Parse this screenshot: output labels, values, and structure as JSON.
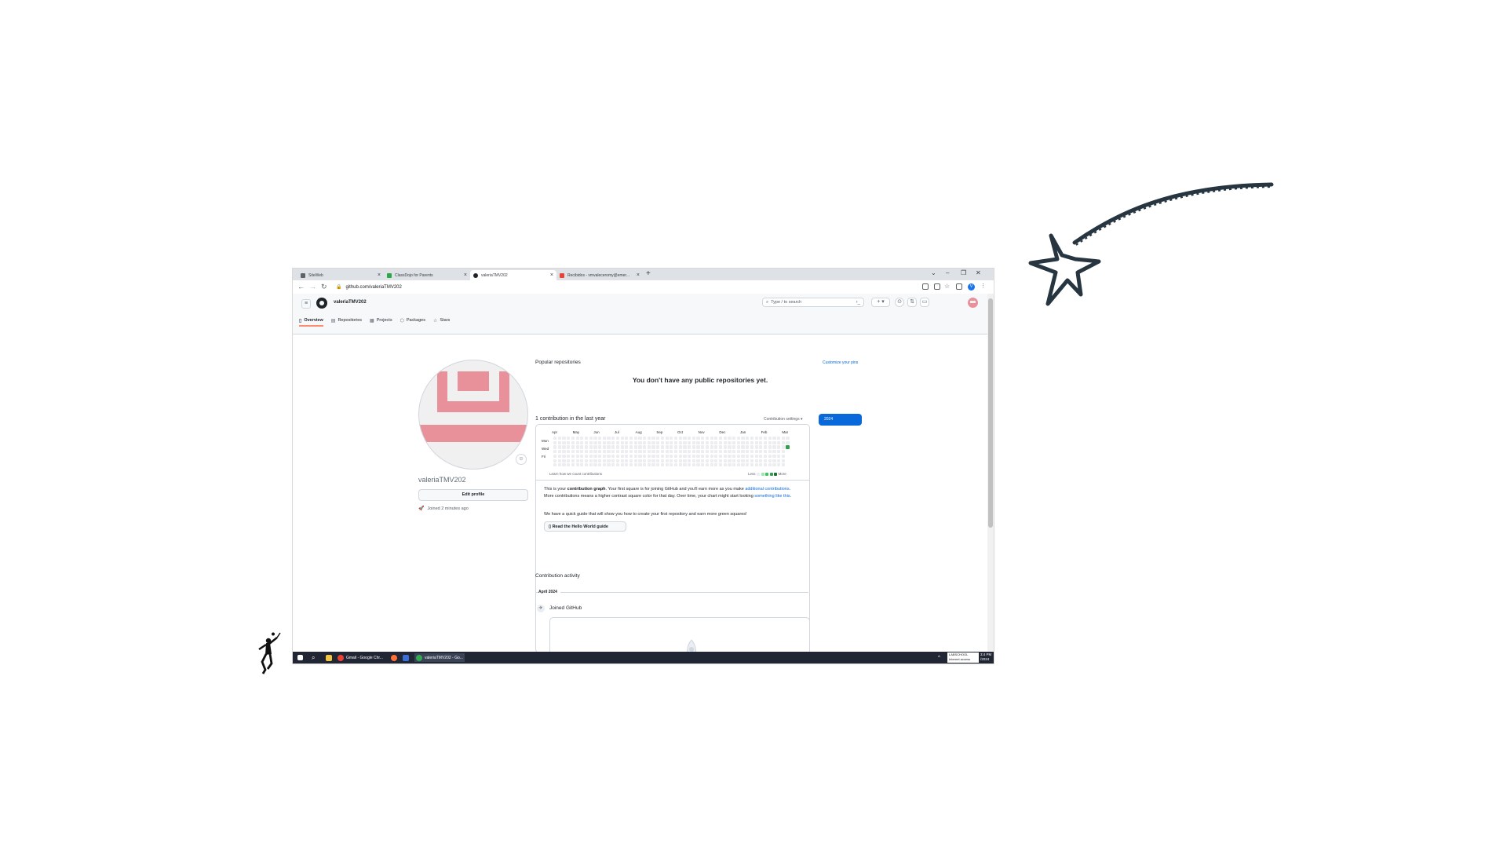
{
  "browser": {
    "tabs": [
      {
        "label": "SiteWeb"
      },
      {
        "label": "ClassDojo for Parents"
      },
      {
        "label": "valeriaTMV202"
      },
      {
        "label": "Recibidos - vmvaleceromy@emer..."
      }
    ],
    "new_tab_symbol": "+",
    "window_controls": [
      "⌄",
      "–",
      "❐",
      "✕"
    ],
    "address": "github.com/valeriaTMV202",
    "profile_initial": "V"
  },
  "github": {
    "username": "valeriaTMV202",
    "search_placeholder": "Type / to search",
    "nav_tabs": [
      {
        "label": "Overview",
        "icon": "book-icon"
      },
      {
        "label": "Repositories",
        "icon": "repo-icon"
      },
      {
        "label": "Projects",
        "icon": "table-icon"
      },
      {
        "label": "Packages",
        "icon": "package-icon"
      },
      {
        "label": "Stars",
        "icon": "star-icon"
      }
    ],
    "profile": {
      "name": "valeriaTMV202",
      "edit_label": "Edit profile",
      "joined": "Joined 2 minutes ago"
    },
    "popular": {
      "title": "Popular repositories",
      "customize": "Customize your pins",
      "empty": "You don't have any public repositories yet."
    },
    "contributions": {
      "count_text": "1 contribution in the last year",
      "settings": "Contribution settings ▾",
      "year": "2024",
      "months": [
        "Apr",
        "May",
        "Jun",
        "Jul",
        "Aug",
        "Sep",
        "Oct",
        "Nov",
        "Dec",
        "Jan",
        "Feb",
        "Mar"
      ],
      "days": [
        "Mon",
        "Wed",
        "Fri"
      ],
      "learn": "Learn how we count contributions",
      "less": "Less",
      "more": "More",
      "colors": {
        "empty": "#ebedf0",
        "l1": "#9be9a8",
        "l2": "#40c463",
        "l3": "#30a14e",
        "l4": "#216e39"
      },
      "note_pre": "This is your ",
      "note_bold": "contribution graph",
      "note_mid": ". Your first square is for joining GitHub and you'll earn more as you make ",
      "note_link1": "additional contributions",
      "note_post": ". More contributions means a higher contrast square color for that day. Over time, your chart might start looking ",
      "note_link2": "something like this",
      "note_end": ".",
      "guide_text": "We have a quick guide that will show you how to create your first repository and earn more green squares!",
      "guide_button": "Read the Hello World guide"
    },
    "activity": {
      "title": "Contribution activity",
      "period": "April 2024",
      "event": "Joined GitHub"
    }
  },
  "taskbar": {
    "items": [
      {
        "label": "Gmail - Google Chr..."
      },
      {
        "label": "valeriaTMV202 - Go..."
      }
    ],
    "network": "LABSCHOOL",
    "network_status": "Internet access",
    "time": "3:4 PM",
    "date": "/2024"
  }
}
